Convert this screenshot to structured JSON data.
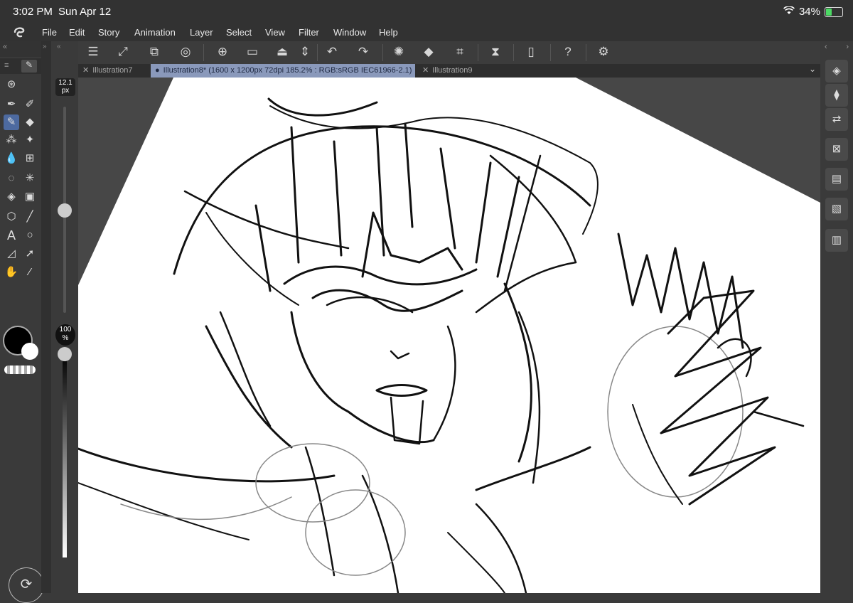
{
  "status": {
    "time": "3:02 PM",
    "date": "Sun Apr 12",
    "battery": "34%"
  },
  "menu": [
    "File",
    "Edit",
    "Story",
    "Animation",
    "Layer",
    "Select",
    "View",
    "Filter",
    "Window",
    "Help"
  ],
  "tabs": {
    "tab1": "Illustration7",
    "tab2": "Illustration8* (1600 x 1200px 72dpi 185.2% : RGB:sRGB IEC61966-2.1)",
    "tab3": "Illustration9"
  },
  "brush": {
    "size_value": "12.1",
    "size_unit": "px",
    "opacity_value": "100",
    "opacity_unit": "%"
  },
  "colors": {
    "main": "#000000",
    "sub": "#ffffff",
    "accent": "#4d6aa0",
    "tab_active": "#8a99bb"
  },
  "icons": {
    "toolbar": [
      "menu-icon",
      "resize-icon",
      "transform-icon",
      "color-wheel-icon",
      "new-canvas-icon",
      "open-folder-icon",
      "save-icon",
      "up-down-icon",
      "undo-icon",
      "redo-icon",
      "loading-icon",
      "fill-icon",
      "crop-icon",
      "flip-icon",
      "device-icon",
      "help-icon",
      "settings-icon"
    ],
    "tools": [
      "download-icon",
      "pen-icon",
      "pencil-icon",
      "brush-icon",
      "eraser-icon",
      "blend-icon",
      "sparkle-icon",
      "drop-icon",
      "grid-icon",
      "lasso-icon",
      "magic-wand-icon",
      "fill-bucket-icon",
      "gradient-icon",
      "cube-icon",
      "line-icon",
      "text-icon",
      "speech-bubble-icon",
      "triangle-ruler-icon",
      "move-arrow-icon",
      "hand-icon",
      "eyedropper-icon"
    ],
    "right": [
      "layers-icon",
      "layer-properties-icon",
      "navigator-icon",
      "sub-view-icon",
      "material-icon",
      "material-image-icon",
      "material-3d-icon"
    ]
  }
}
